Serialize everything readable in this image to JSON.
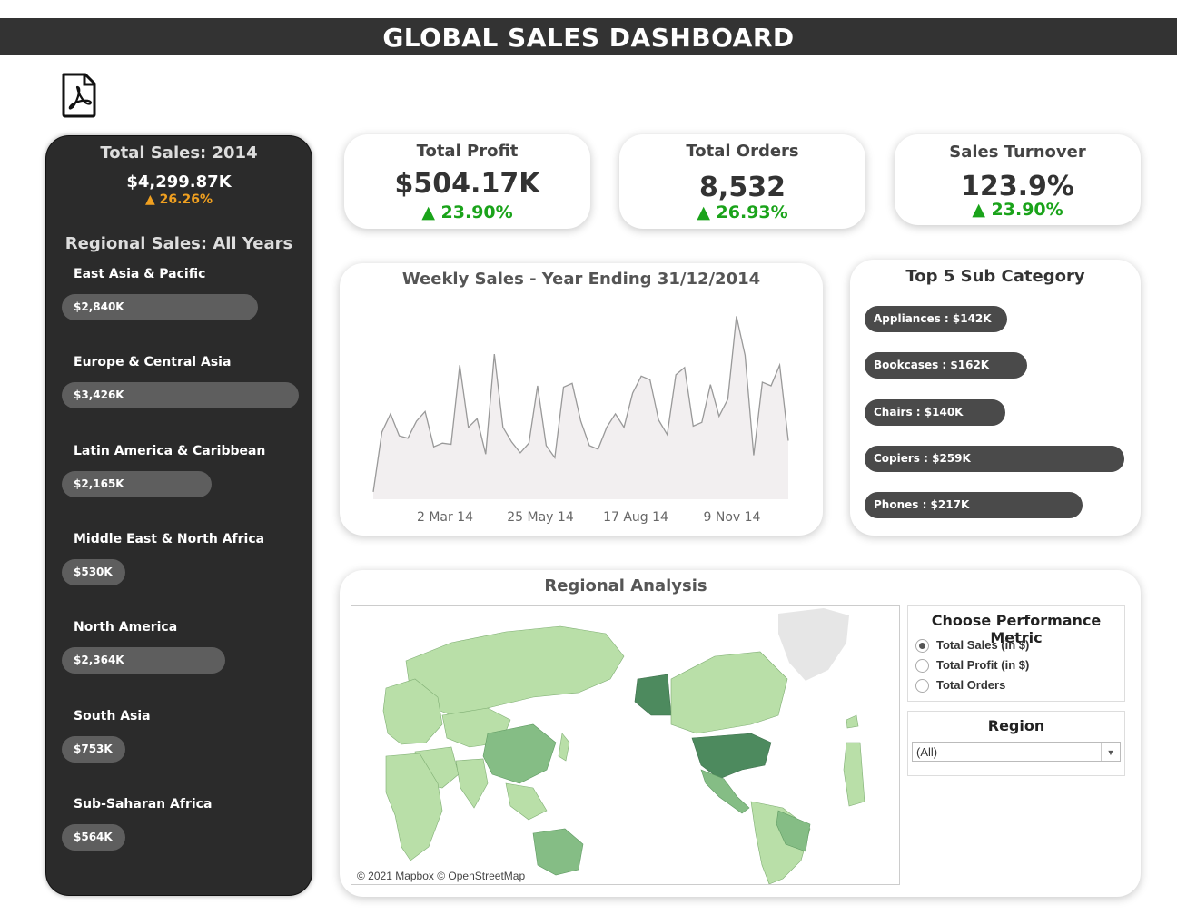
{
  "header": {
    "title": "GLOBAL SALES DASHBOARD",
    "pdf_icon": "pdf-file-icon"
  },
  "left_panel": {
    "total_title": "Total Sales: 2014",
    "total_value": "$4,299.87K",
    "total_delta": "▲ 26.26%",
    "delta_color": "#f0a020",
    "regional_title": "Regional Sales: All Years",
    "regions": [
      {
        "label": "East Asia & Pacific",
        "value": "$2,840K",
        "amount_k": 2840
      },
      {
        "label": "Europe & Central Asia",
        "value": "$3,426K",
        "amount_k": 3426
      },
      {
        "label": "Latin America & Caribbean",
        "value": "$2,165K",
        "amount_k": 2165
      },
      {
        "label": "Middle East & North Africa",
        "value": "$530K",
        "amount_k": 530
      },
      {
        "label": "North America",
        "value": "$2,364K",
        "amount_k": 2364
      },
      {
        "label": "South Asia",
        "value": "$753K",
        "amount_k": 753
      },
      {
        "label": "Sub-Saharan Africa",
        "value": "$564K",
        "amount_k": 564
      }
    ]
  },
  "kpis": [
    {
      "title": "Total Profit",
      "value": "$504.17K",
      "delta": "▲ 23.90%"
    },
    {
      "title": "Total Orders",
      "value": "8,532",
      "delta": "▲ 26.93%"
    },
    {
      "title": "Sales Turnover",
      "value": "123.9%",
      "delta": "▲ 23.90%"
    }
  ],
  "kpi_delta_color": "#1aa31a",
  "weekly_chart": {
    "title": "Weekly Sales - Year Ending 31/12/2014",
    "chart_data": {
      "type": "area",
      "x_tick_labels": [
        "2 Mar 14",
        "25 May 14",
        "17 Aug 14",
        "9 Nov 14"
      ],
      "values": [
        6,
        55,
        70,
        52,
        50,
        64,
        72,
        43,
        46,
        45,
        110,
        59,
        66,
        37,
        119,
        59,
        47,
        38,
        46,
        93,
        44,
        34,
        92,
        95,
        64,
        44,
        41,
        59,
        70,
        59,
        87,
        101,
        98,
        65,
        53,
        102,
        108,
        60,
        63,
        94,
        68,
        82,
        150,
        118,
        36,
        96,
        93,
        110,
        48
      ],
      "grid": false,
      "line_color": "#999999",
      "fill_color": "#f2eff0"
    }
  },
  "top5": {
    "title": "Top 5 Sub Category",
    "chart_data": {
      "type": "bar",
      "categories": [
        "Appliances",
        "Bookcases",
        "Chairs",
        "Copiers",
        "Phones"
      ],
      "values": [
        142,
        162,
        140,
        259,
        217
      ],
      "labels": [
        "Appliances : $142K",
        "Bookcases : $162K",
        "Chairs : $140K",
        "Copiers : $259K",
        "Phones : $217K"
      ]
    }
  },
  "regional_analysis": {
    "title": "Regional Analysis",
    "attribution": "© 2021 Mapbox © OpenStreetMap",
    "map_colors": {
      "dark": "#4d8a5e",
      "medium": "#85bd85",
      "light": "#b9dfa8",
      "no_data": "#e6e6e6"
    },
    "metric_param": {
      "title": "Choose Performance Metric",
      "options": [
        "Total Sales (in $)",
        "Total Profit (in $)",
        "Total Orders"
      ],
      "selected": "Total Sales (in $)"
    },
    "region_filter": {
      "title": "Region",
      "selected": "(All)"
    }
  }
}
